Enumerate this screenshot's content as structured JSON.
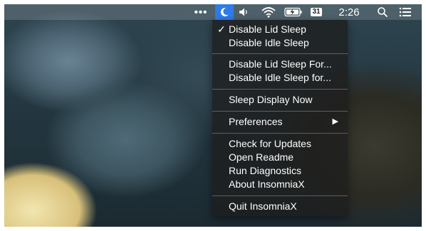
{
  "menubar": {
    "more_glyph": "•••",
    "calendar_day": "31",
    "clock": "2:26"
  },
  "icons": {
    "app": "insomniax-moon-icon",
    "volume": "volume-icon",
    "wifi": "wifi-icon",
    "battery": "battery-charging-icon",
    "search": "search-icon",
    "notifications": "list-icon"
  },
  "menu": {
    "checkmark": "✓",
    "items": [
      {
        "label": "Disable Lid Sleep",
        "checked": true
      },
      {
        "label": "Disable Idle Sleep"
      },
      {
        "label": "Disable Lid Sleep For..."
      },
      {
        "label": "Disable Idle Sleep for..."
      },
      {
        "label": "Sleep Display Now"
      },
      {
        "label": "Preferences",
        "submenu": true
      },
      {
        "label": "Check for Updates"
      },
      {
        "label": "Open Readme"
      },
      {
        "label": "Run Diagnostics"
      },
      {
        "label": "About InsomniaX"
      },
      {
        "label": "Quit InsomniaX"
      }
    ],
    "submenu_arrow": "▶"
  },
  "colors": {
    "app_icon_bg": "#2f7be8",
    "menu_bg": "#1e1e1e",
    "text": "#ffffff"
  }
}
